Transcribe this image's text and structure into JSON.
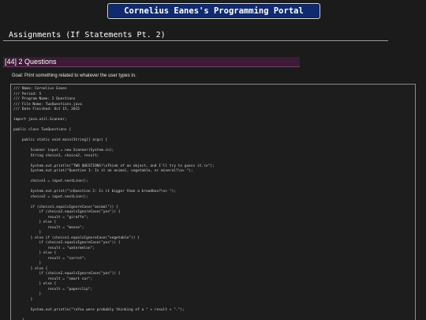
{
  "header": {
    "portal_title": "Cornelius Eanes's Programming Portal"
  },
  "section": {
    "heading": "Assignments (If Statements Pt. 2)"
  },
  "problem": {
    "title": "[44] 2 Questions",
    "goal": "Goal: Print something related to whatever the user types in."
  },
  "code": {
    "lines": [
      "/// Name: Cornelius Eanes",
      "/// Period: 5",
      "/// Program Name: 2 Questions",
      "/// File Name: TwoQuestions.java",
      "/// Date Finished: Oct 15, 2015",
      "",
      "import java.util.Scanner;",
      "",
      "public class TwoQuestions {",
      "",
      "    public static void main(String[] args) {",
      "",
      "        Scanner input = new Scanner(System.in);",
      "        String choice1, choice2, result;",
      "",
      "        System.out.println(\"TWO QUESTIONS!\\nThink of an object, and I'll try to guess it.\\n\");",
      "        System.out.print(\"Question 1: Is it an animal, vegetable, or mineral?\\n> \");",
      "",
      "        choice1 = input.nextLine();",
      "",
      "        System.out.print(\"\\nQuestion 2: Is it bigger than a breadbox?\\n> \");",
      "        choice2 = input.nextLine();",
      "",
      "        if (choice1.equalsIgnoreCase(\"animal\")) {",
      "            if (choice2.equalsIgnoreCase(\"yes\")) {",
      "                result = \"giraffe\";",
      "            } else {",
      "                result = \"moose\";",
      "            }",
      "        } else if (choice1.equalsIgnoreCase(\"vegetable\")) {",
      "            if (choice2.equalsIgnoreCase(\"yes\")) {",
      "                result = \"watermelon\";",
      "            } else {",
      "                result = \"carrot\";",
      "            }",
      "        } else {",
      "            if (choice2.equalsIgnoreCase(\"yes\")) {",
      "                result = \"smart car\";",
      "            } else {",
      "                result = \"paperclip\";",
      "            }",
      "        }",
      "",
      "        System.out.println(\"\\nYou were probably thinking of a \" + result + \".\");",
      "",
      "    }"
    ]
  }
}
